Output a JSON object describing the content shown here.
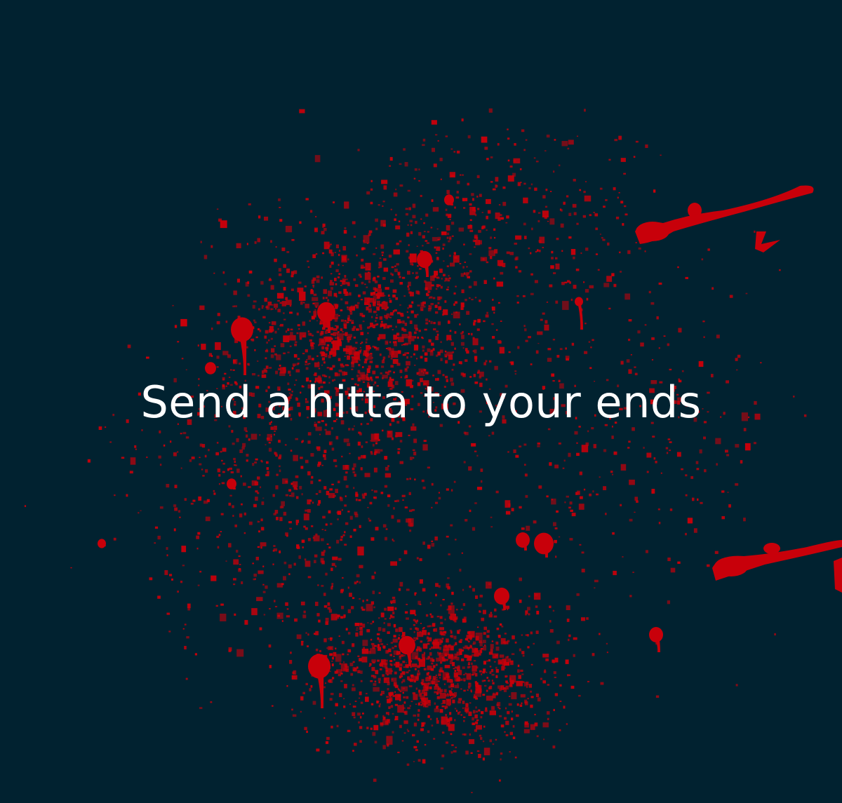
{
  "caption": "Send a hitta to your ends",
  "colors": {
    "background": "#012230",
    "splatter": "#c8000a",
    "text": "#ffffff"
  }
}
